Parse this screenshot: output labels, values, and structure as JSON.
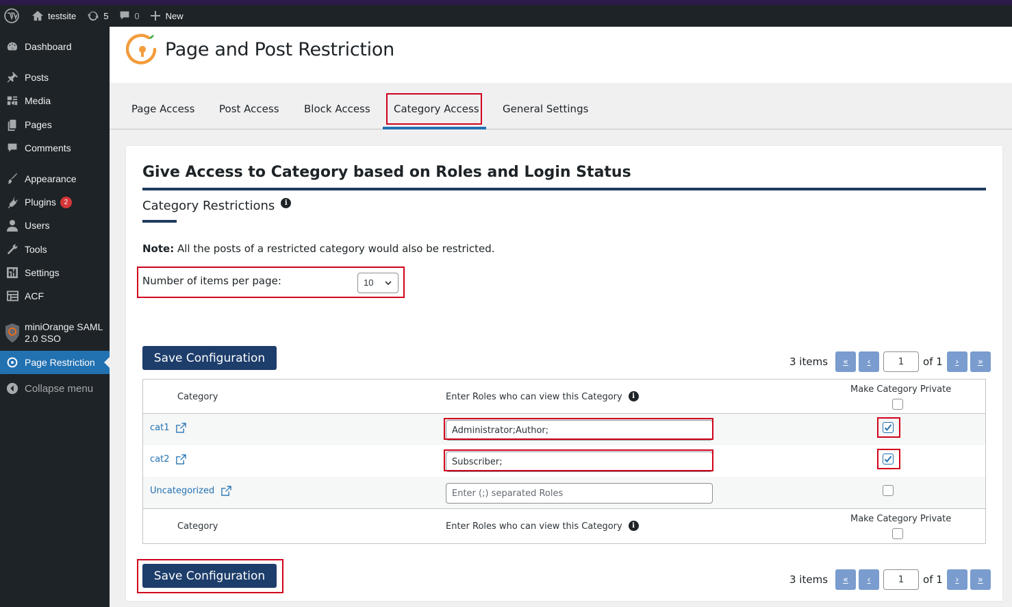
{
  "adminbar": {
    "site_name": "testsite",
    "updates_count": "5",
    "comments_count": "0",
    "new_label": "New"
  },
  "sidebar": {
    "items": [
      {
        "label": "Dashboard"
      },
      {
        "label": "Posts"
      },
      {
        "label": "Media"
      },
      {
        "label": "Pages"
      },
      {
        "label": "Comments"
      },
      {
        "label": "Appearance"
      },
      {
        "label": "Plugins",
        "badge": "2"
      },
      {
        "label": "Users"
      },
      {
        "label": "Tools"
      },
      {
        "label": "Settings"
      },
      {
        "label": "ACF"
      },
      {
        "label_line1": "miniOrange SAML",
        "label_line2": "2.0 SSO"
      },
      {
        "label": "Page Restriction"
      },
      {
        "label": "Collapse menu"
      }
    ]
  },
  "header": {
    "title": "Page and Post Restriction"
  },
  "tabs": [
    {
      "label": "Page Access"
    },
    {
      "label": "Post Access"
    },
    {
      "label": "Block Access"
    },
    {
      "label": "Category Access"
    },
    {
      "label": "General Settings"
    }
  ],
  "main": {
    "section_title": "Give Access to Category based on Roles and Login Status",
    "sub_title": "Category Restrictions",
    "note_bold": "Note:",
    "note_text": " All the posts of a restricted category would also be restricted.",
    "per_page_label": "Number of items per page:",
    "per_page_value": "10",
    "save_label": "Save Configuration",
    "pager": {
      "items_text": "3 items",
      "first": "«",
      "prev": "‹",
      "current_page": "1",
      "of_text": "of 1",
      "next": "›",
      "last": "»"
    },
    "table": {
      "headers": {
        "category": "Category",
        "roles": "Enter Roles who can view this Category",
        "private": "Make Category Private"
      },
      "rows": [
        {
          "category": "cat1",
          "roles": "Administrator;Author;",
          "private": true
        },
        {
          "category": "cat2",
          "roles": "Subscriber;",
          "private": true
        },
        {
          "category": "Uncategorized",
          "roles": "",
          "placeholder": "Enter (;) separated Roles",
          "private": false
        }
      ]
    }
  },
  "colors": {
    "accent": "#2271b1",
    "highlight_box": "#d0021b",
    "button": "#1d3d6b"
  }
}
